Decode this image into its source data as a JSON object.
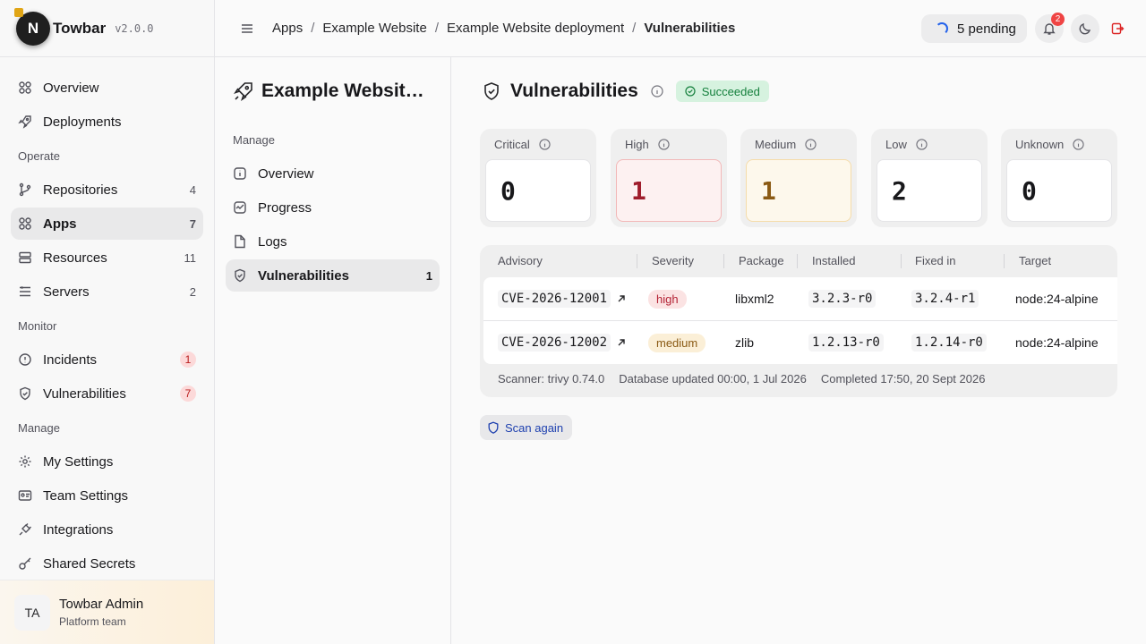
{
  "brand": {
    "logo_letter": "N",
    "name": "Towbar",
    "version": "v2.0.0"
  },
  "sidebar": {
    "top_items": [
      {
        "label": "Overview",
        "icon": "grid-icon"
      },
      {
        "label": "Deployments",
        "icon": "rocket-icon"
      }
    ],
    "operate_label": "Operate",
    "operate_items": [
      {
        "label": "Repositories",
        "count": "4",
        "icon": "git-branch-icon"
      },
      {
        "label": "Apps",
        "count": "7",
        "icon": "grid-icon",
        "active": true
      },
      {
        "label": "Resources",
        "count": "11",
        "icon": "database-icon"
      },
      {
        "label": "Servers",
        "count": "2",
        "icon": "server-icon"
      }
    ],
    "monitor_label": "Monitor",
    "monitor_items": [
      {
        "label": "Incidents",
        "badge": "1",
        "icon": "alert-circle-icon"
      },
      {
        "label": "Vulnerabilities",
        "badge": "7",
        "icon": "shield-check-icon"
      }
    ],
    "manage_label": "Manage",
    "manage_items": [
      {
        "label": "My Settings",
        "icon": "gear-icon"
      },
      {
        "label": "Team Settings",
        "icon": "id-card-icon"
      },
      {
        "label": "Integrations",
        "icon": "plug-icon"
      },
      {
        "label": "Shared Secrets",
        "icon": "key-icon"
      }
    ],
    "user": {
      "initials": "TA",
      "name": "Towbar Admin",
      "team": "Platform team"
    }
  },
  "header": {
    "breadcrumbs": [
      "Apps",
      "Example Website",
      "Example Website deployment",
      "Vulnerabilities"
    ],
    "pending_label": "5 pending",
    "notification_count": "2"
  },
  "subnav": {
    "title": "Example Website deployment",
    "section_label": "Manage",
    "items": [
      {
        "label": "Overview",
        "icon": "info-icon"
      },
      {
        "label": "Progress",
        "icon": "activity-icon"
      },
      {
        "label": "Logs",
        "icon": "file-icon"
      },
      {
        "label": "Vulnerabilities",
        "icon": "shield-check-icon",
        "count": "1",
        "active": true
      }
    ]
  },
  "main": {
    "title": "Vulnerabilities",
    "status": "Succeeded",
    "severity_cards": [
      {
        "label": "Critical",
        "value": "0"
      },
      {
        "label": "High",
        "value": "1"
      },
      {
        "label": "Medium",
        "value": "1"
      },
      {
        "label": "Low",
        "value": "2"
      },
      {
        "label": "Unknown",
        "value": "0"
      }
    ],
    "table": {
      "columns": [
        "Advisory",
        "Severity",
        "Package",
        "Installed",
        "Fixed in",
        "Target"
      ],
      "rows": [
        {
          "advisory": "CVE-2026-12001",
          "severity": "high",
          "package": "libxml2",
          "installed": "3.2.3-r0",
          "fixed": "3.2.4-r1",
          "target": "node:24-alpine"
        },
        {
          "advisory": "CVE-2026-12002",
          "severity": "medium",
          "package": "zlib",
          "installed": "1.2.13-r0",
          "fixed": "1.2.14-r0",
          "target": "node:24-alpine"
        }
      ],
      "footer": {
        "scanner": "Scanner: trivy 0.74.0",
        "db_updated": "Database updated 00:00, 1 Jul 2026",
        "completed": "Completed 17:50, 20 Sept 2026"
      }
    },
    "scan_button": "Scan again"
  }
}
